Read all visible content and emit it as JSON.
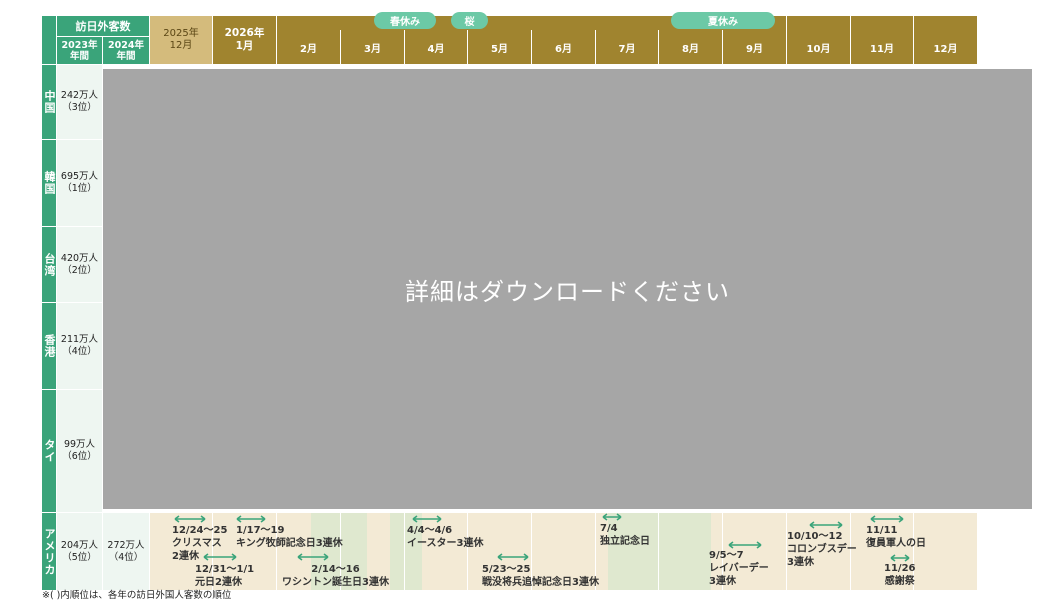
{
  "header": {
    "visitors_title": "訪日外客数",
    "year_2023": "2023年\n年間",
    "year_2024": "2024年\n年間",
    "months": [
      "2025年\n12月",
      "2026年\n1月",
      "2月",
      "3月",
      "4月",
      "5月",
      "6月",
      "7月",
      "8月",
      "9月",
      "10月",
      "11月",
      "12月"
    ],
    "season_tags": [
      "春休み",
      "桜",
      "夏休み"
    ]
  },
  "countries": [
    {
      "name": "中国",
      "v2023": "242万人\n（3位）",
      "v2024": ""
    },
    {
      "name": "韓国",
      "v2023": "695万人\n（1位）",
      "v2024": ""
    },
    {
      "name": "台湾",
      "v2023": "420万人\n（2位）",
      "v2024": ""
    },
    {
      "name": "香港",
      "v2023": "211万人\n（4位）",
      "v2024": ""
    },
    {
      "name": "タイ",
      "v2023": "99万人\n（6位）",
      "v2024": ""
    },
    {
      "name": "アメリカ",
      "v2023": "204万人\n（5位）",
      "v2024": "272万人\n（4位）"
    }
  ],
  "overlay_text": "詳細はダウンロードください",
  "usa_events": [
    {
      "label": "12/24〜25\nクリスマス\n2連休"
    },
    {
      "label": "12/31〜1/1\n元日2連休"
    },
    {
      "label": "1/17〜19\nキング牧師記念日3連休"
    },
    {
      "label": "2/14〜16\nワシントン誕生日3連休"
    },
    {
      "label": "4/4〜4/6\nイースター3連休"
    },
    {
      "label": "5/23〜25\n戦没将兵追悼記念日3連休"
    },
    {
      "label": "7/4\n独立記念日"
    },
    {
      "label": "9/5〜7\nレイバーデー\n3連休"
    },
    {
      "label": "10/10〜12\nコロンブスデー\n3連休"
    },
    {
      "label": "11/11\n復員軍人の日"
    },
    {
      "label": "11/26\n感謝祭"
    }
  ],
  "footnote": "※( )内順位は、各年の訪日外国人客数の順位",
  "colors": {
    "green": "#3aa47a",
    "olive": "#a0842f",
    "tan": "#d4bb7c",
    "pill": "#6cc9a6",
    "arrow": "#3aa47a",
    "overlay": "#a6a6a6"
  },
  "icons": [
    "double-arrow-icon"
  ]
}
